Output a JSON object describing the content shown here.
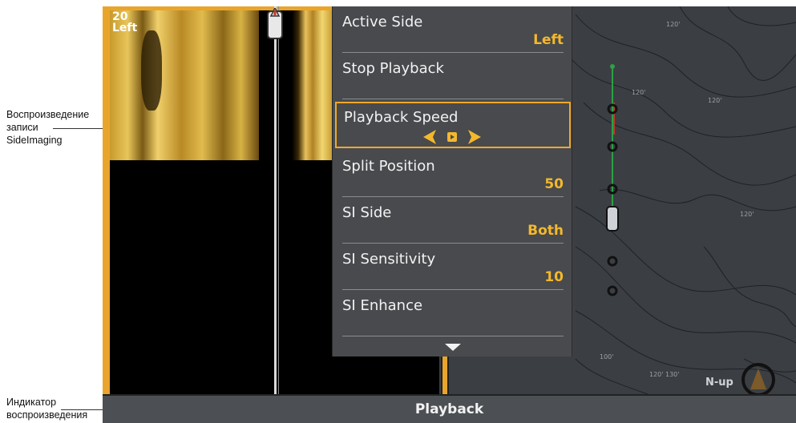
{
  "callouts": {
    "sideimaging": [
      "Воспроизведение",
      "записи",
      "SideImaging"
    ],
    "indicator": [
      "Индикатор",
      "воспроизведения"
    ]
  },
  "sonar": {
    "readout_line1": "20",
    "readout_line2": "Left"
  },
  "menu": {
    "items": [
      {
        "label": "Active Side",
        "value": "Left"
      },
      {
        "label": "Stop Playback",
        "value": ""
      },
      {
        "label": "Playback Speed",
        "value": ""
      },
      {
        "label": "Split Position",
        "value": "50"
      },
      {
        "label": "SI Side",
        "value": "Both"
      },
      {
        "label": "SI Sensitivity",
        "value": "10"
      },
      {
        "label": "SI Enhance",
        "value": ""
      }
    ],
    "selected_index": 2
  },
  "chart": {
    "orientation": "N-up",
    "depth_labels": [
      "120'",
      "120'",
      "120'",
      "120'",
      "100'",
      "120'",
      "130'"
    ]
  },
  "status": {
    "mode": "Playback"
  },
  "colors": {
    "accent": "#f0a82b",
    "menu_bg": "#484a4d",
    "value_text": "#f4b82c"
  }
}
